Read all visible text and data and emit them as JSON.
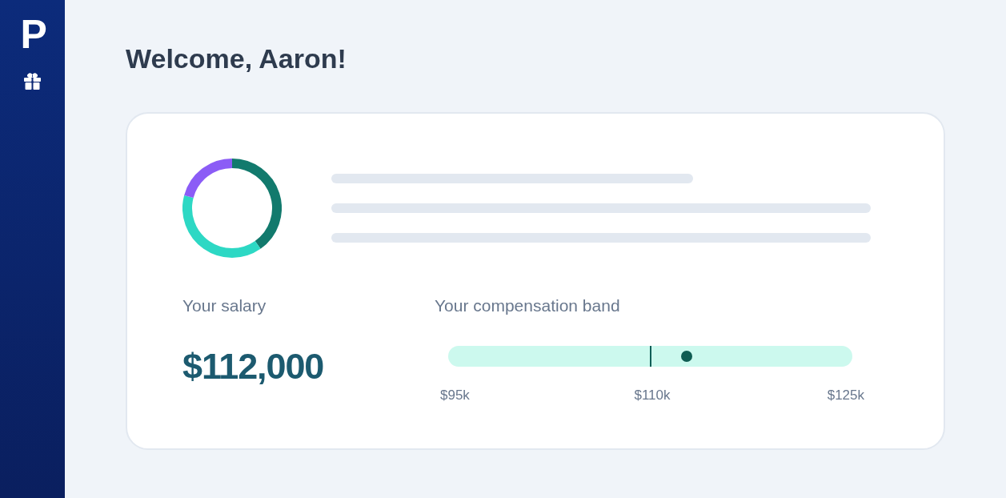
{
  "sidebar": {
    "logo": "P"
  },
  "heading": "Welcome, Aaron!",
  "salary": {
    "label": "Your salary",
    "value": "$112,000"
  },
  "compensation_band": {
    "label": "Your compensation band",
    "markers": [
      {
        "kind": "line",
        "level": 0.5
      },
      {
        "kind": "dot",
        "level": 0.59
      }
    ],
    "ticks": [
      "$95k",
      "$110k",
      "$125k"
    ]
  }
}
